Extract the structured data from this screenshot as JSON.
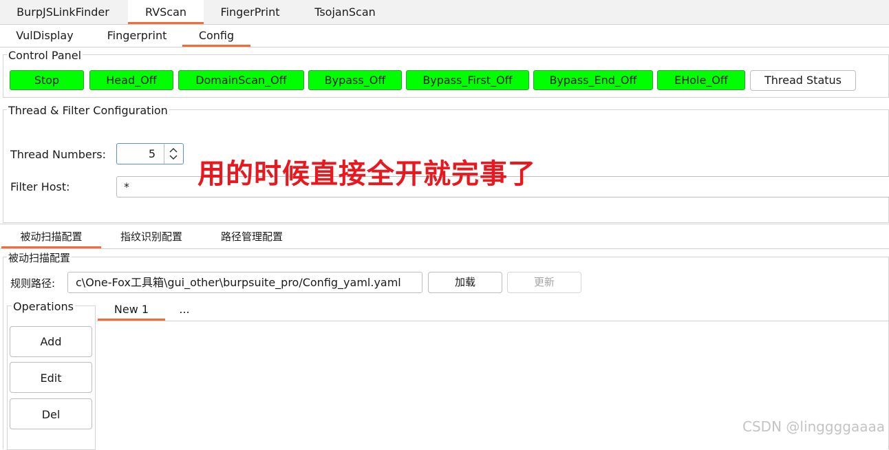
{
  "top_tabs": [
    "BurpJSLinkFinder",
    "RVScan",
    "FingerPrint",
    "TsojanScan"
  ],
  "sub_tabs": [
    "VulDisplay",
    "Fingerprint",
    "Config"
  ],
  "control_panel": {
    "title": "Control Panel",
    "buttons": [
      "Stop",
      "Head_Off",
      "DomainScan_Off",
      "Bypass_Off",
      "Bypass_First_Off",
      "Bypass_End_Off",
      "EHole_Off"
    ],
    "thread_status": "Thread Status",
    "active_color": "#00ff00"
  },
  "thread_filter": {
    "title": "Thread & Filter Configuration",
    "thread_label": "Thread Numbers:",
    "thread_value": "5",
    "filter_label": "Filter Host:",
    "filter_value": "*"
  },
  "overlay_text": "用的时候直接全开就完事了",
  "config_tabs": [
    "被动扫描配置",
    "指纹识别配置",
    "路径管理配置"
  ],
  "passive_scan": {
    "title": "被动扫描配置",
    "path_label": "规则路径:",
    "path_value": "c\\One-Fox工具箱\\gui_other\\burpsuite_pro/Config_yaml.yaml",
    "load_button": "加载",
    "update_button": "更新"
  },
  "operations": {
    "title": "Operations",
    "add": "Add",
    "edit": "Edit",
    "del": "Del"
  },
  "rule_tabs": [
    "New 1",
    "..."
  ],
  "watermark": "CSDN @linggggaaaa"
}
